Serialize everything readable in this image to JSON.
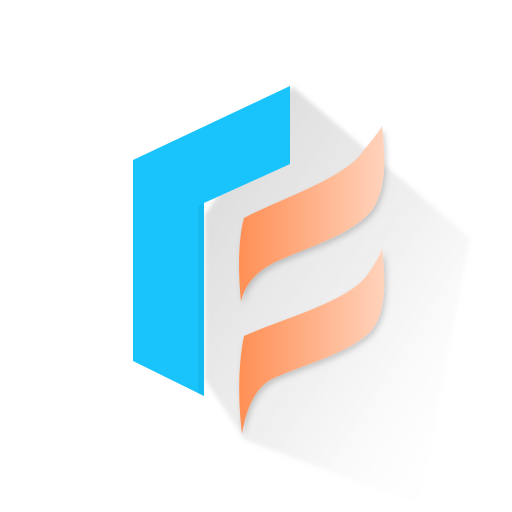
{
  "logo": {
    "icon": "stylized-letter-f-logo-icon",
    "colors": {
      "blue": "#19C3FB",
      "blue_dark": "#12B2EA",
      "orange_start": "#FF8F55",
      "orange_end": "#FFD3BC",
      "background": "#FFFFFF",
      "shadow": "#9A9A9A"
    }
  }
}
